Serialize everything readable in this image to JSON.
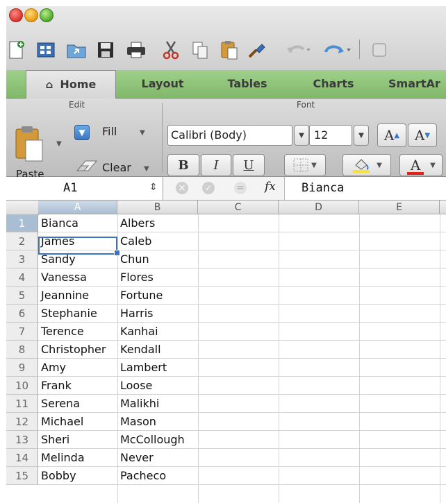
{
  "toolbar": {
    "icons": [
      "new-workbook-icon",
      "templates-icon",
      "open-icon",
      "save-icon",
      "print-icon",
      "cut-icon",
      "copy-icon",
      "paste-icon",
      "format-painter-icon",
      "undo-icon",
      "redo-icon"
    ]
  },
  "tabs": [
    {
      "label": "Home"
    },
    {
      "label": "Layout"
    },
    {
      "label": "Tables"
    },
    {
      "label": "Charts"
    },
    {
      "label": "SmartAr"
    }
  ],
  "ribbon": {
    "edit_label": "Edit",
    "font_label": "Font",
    "paste_label": "Paste",
    "fill_label": "Fill",
    "clear_label": "Clear",
    "font_name": "Calibri (Body)",
    "font_size": "12",
    "bold": "B",
    "italic": "I",
    "underline": "U",
    "grow_font": "A",
    "shrink_font": "A",
    "font_color_letter": "A",
    "colors": {
      "highlight": "#f5e33a",
      "font_color": "#e0221a"
    }
  },
  "formula_bar": {
    "cell_ref": "A1",
    "fx": "fx",
    "value": "Bianca"
  },
  "sheet": {
    "columns": [
      "A",
      "B",
      "C",
      "D",
      "E"
    ],
    "rows": [
      {
        "num": "1",
        "a": "Bianca",
        "b": "Albers"
      },
      {
        "num": "2",
        "a": "James",
        "b": "Caleb"
      },
      {
        "num": "3",
        "a": "Sandy",
        "b": "Chun"
      },
      {
        "num": "4",
        "a": "Vanessa",
        "b": "Flores"
      },
      {
        "num": "5",
        "a": "Jeannine",
        "b": "Fortune"
      },
      {
        "num": "6",
        "a": "Stephanie",
        "b": "Harris"
      },
      {
        "num": "7",
        "a": "Terence",
        "b": "Kanhai"
      },
      {
        "num": "8",
        "a": "Christopher",
        "b": "Kendall"
      },
      {
        "num": "9",
        "a": "Amy",
        "b": "Lambert"
      },
      {
        "num": "10",
        "a": "Frank",
        "b": "Loose"
      },
      {
        "num": "11",
        "a": "Serena",
        "b": "Malikhi"
      },
      {
        "num": "12",
        "a": "Michael",
        "b": "Mason"
      },
      {
        "num": "13",
        "a": "Sheri",
        "b": "McCollough"
      },
      {
        "num": "14",
        "a": "Melinda",
        "b": "Never"
      },
      {
        "num": "15",
        "a": "Bobby",
        "b": "Pacheco"
      }
    ]
  }
}
